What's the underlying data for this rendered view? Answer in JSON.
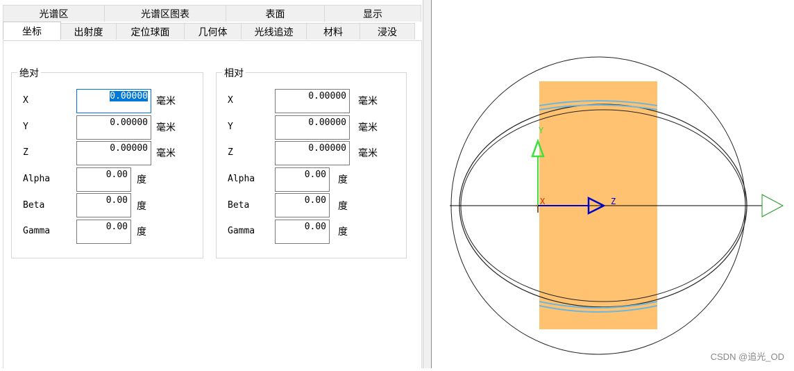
{
  "tabs_row1": [
    "光谱区",
    "光谱区图表",
    "表面",
    "显示"
  ],
  "tabs_row2": [
    "坐标",
    "出射度",
    "定位球面",
    "几何体",
    "光线追迹",
    "材料",
    "浸没"
  ],
  "absolute": {
    "title": "绝对",
    "x": {
      "label": "X",
      "value": "0.00000",
      "unit": "毫米"
    },
    "y": {
      "label": "Y",
      "value": "0.00000",
      "unit": "毫米"
    },
    "z": {
      "label": "Z",
      "value": "0.00000",
      "unit": "毫米"
    },
    "alpha": {
      "label": "Alpha",
      "value": "0.00",
      "unit": "度"
    },
    "beta": {
      "label": "Beta",
      "value": "0.00",
      "unit": "度"
    },
    "gamma": {
      "label": "Gamma",
      "value": "0.00",
      "unit": "度"
    }
  },
  "relative": {
    "title": "相对",
    "x": {
      "label": "X",
      "value": "0.00000",
      "unit": "毫米"
    },
    "y": {
      "label": "Y",
      "value": "0.00000",
      "unit": "毫米"
    },
    "z": {
      "label": "Z",
      "value": "0.00000",
      "unit": "毫米"
    },
    "alpha": {
      "label": "Alpha",
      "value": "0.00",
      "unit": "度"
    },
    "beta": {
      "label": "Beta",
      "value": "0.00",
      "unit": "度"
    },
    "gamma": {
      "label": "Gamma",
      "value": "0.00",
      "unit": "度"
    }
  },
  "viewport": {
    "axis_y": "Y",
    "axis_x": "X",
    "axis_z": "Z",
    "colors": {
      "body": "#ffc271",
      "y_axis": "#3de03d",
      "z_axis": "#0000cc",
      "ring": "#6fb6dc",
      "origin": "#d05020"
    }
  },
  "watermark": "CSDN @追光_OD"
}
